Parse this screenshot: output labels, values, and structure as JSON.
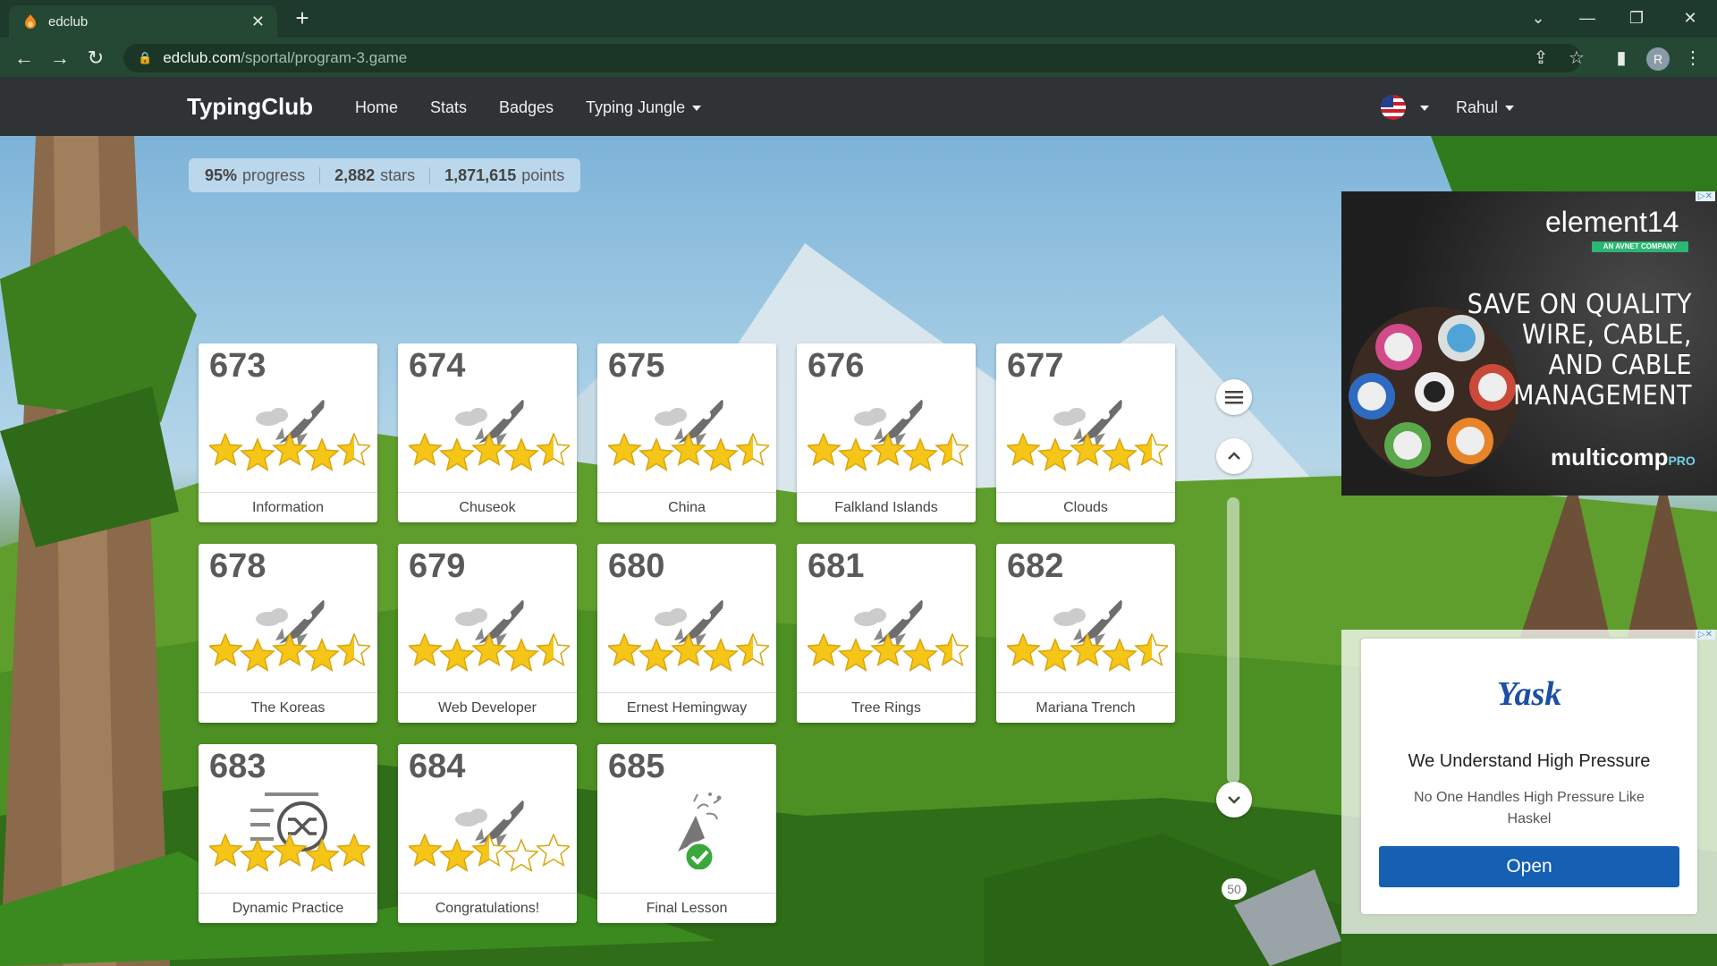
{
  "browser": {
    "tab_title": "edclub",
    "url_host": "edclub.com",
    "url_path": "/sportal/program-3.game",
    "profile_initial": "R"
  },
  "site": {
    "brand": "TypingClub",
    "nav": [
      "Home",
      "Stats",
      "Badges",
      "Typing Jungle"
    ],
    "user": "Rahul"
  },
  "stats": {
    "progress_value": "95%",
    "progress_label": "progress",
    "stars_value": "2,882",
    "stars_label": "stars",
    "points_value": "1,871,615",
    "points_label": "points"
  },
  "lessons": [
    {
      "number": "673",
      "title": "Information",
      "stars": 4.5,
      "icon": "rocket-icon"
    },
    {
      "number": "674",
      "title": "Chuseok",
      "stars": 4.5,
      "icon": "rocket-icon"
    },
    {
      "number": "675",
      "title": "China",
      "stars": 4.5,
      "icon": "rocket-icon"
    },
    {
      "number": "676",
      "title": "Falkland Islands",
      "stars": 4.5,
      "icon": "rocket-icon"
    },
    {
      "number": "677",
      "title": "Clouds",
      "stars": 4.5,
      "icon": "rocket-icon"
    },
    {
      "number": "678",
      "title": "The Koreas",
      "stars": 4.5,
      "icon": "rocket-icon"
    },
    {
      "number": "679",
      "title": "Web Developer",
      "stars": 4.5,
      "icon": "rocket-icon"
    },
    {
      "number": "680",
      "title": "Ernest Hemingway",
      "stars": 4.5,
      "icon": "rocket-icon"
    },
    {
      "number": "681",
      "title": "Tree Rings",
      "stars": 4.5,
      "icon": "rocket-icon"
    },
    {
      "number": "682",
      "title": "Mariana Trench",
      "stars": 4.5,
      "icon": "rocket-icon"
    },
    {
      "number": "683",
      "title": "Dynamic Practice",
      "stars": 5,
      "icon": "shuffle-practice-icon"
    },
    {
      "number": "684",
      "title": "Congratulations!",
      "stars": 2.5,
      "icon": "rocket-icon"
    },
    {
      "number": "685",
      "title": "Final Lesson",
      "stars": 0,
      "icon": "party-popper-check-icon"
    }
  ],
  "scroller": {
    "page_badge": "50"
  },
  "ads": {
    "element14": {
      "brand": "element14",
      "tagline": "AN AVNET COMPANY",
      "headline_lines": [
        "SAVE ON QUALITY",
        "WIRE, CABLE,",
        "AND CABLE",
        "MANAGEMENT"
      ],
      "product_brand": "multicomp",
      "product_suffix": "PRO"
    },
    "haskel": {
      "logo": "Yask",
      "headline": "We Understand High Pressure",
      "subtext": "No One Handles High Pressure Like Haskel",
      "button": "Open"
    }
  },
  "colors": {
    "accent_blue": "#1560b3",
    "star_gold": "#f5c518",
    "nav_bg": "#2f3336"
  }
}
